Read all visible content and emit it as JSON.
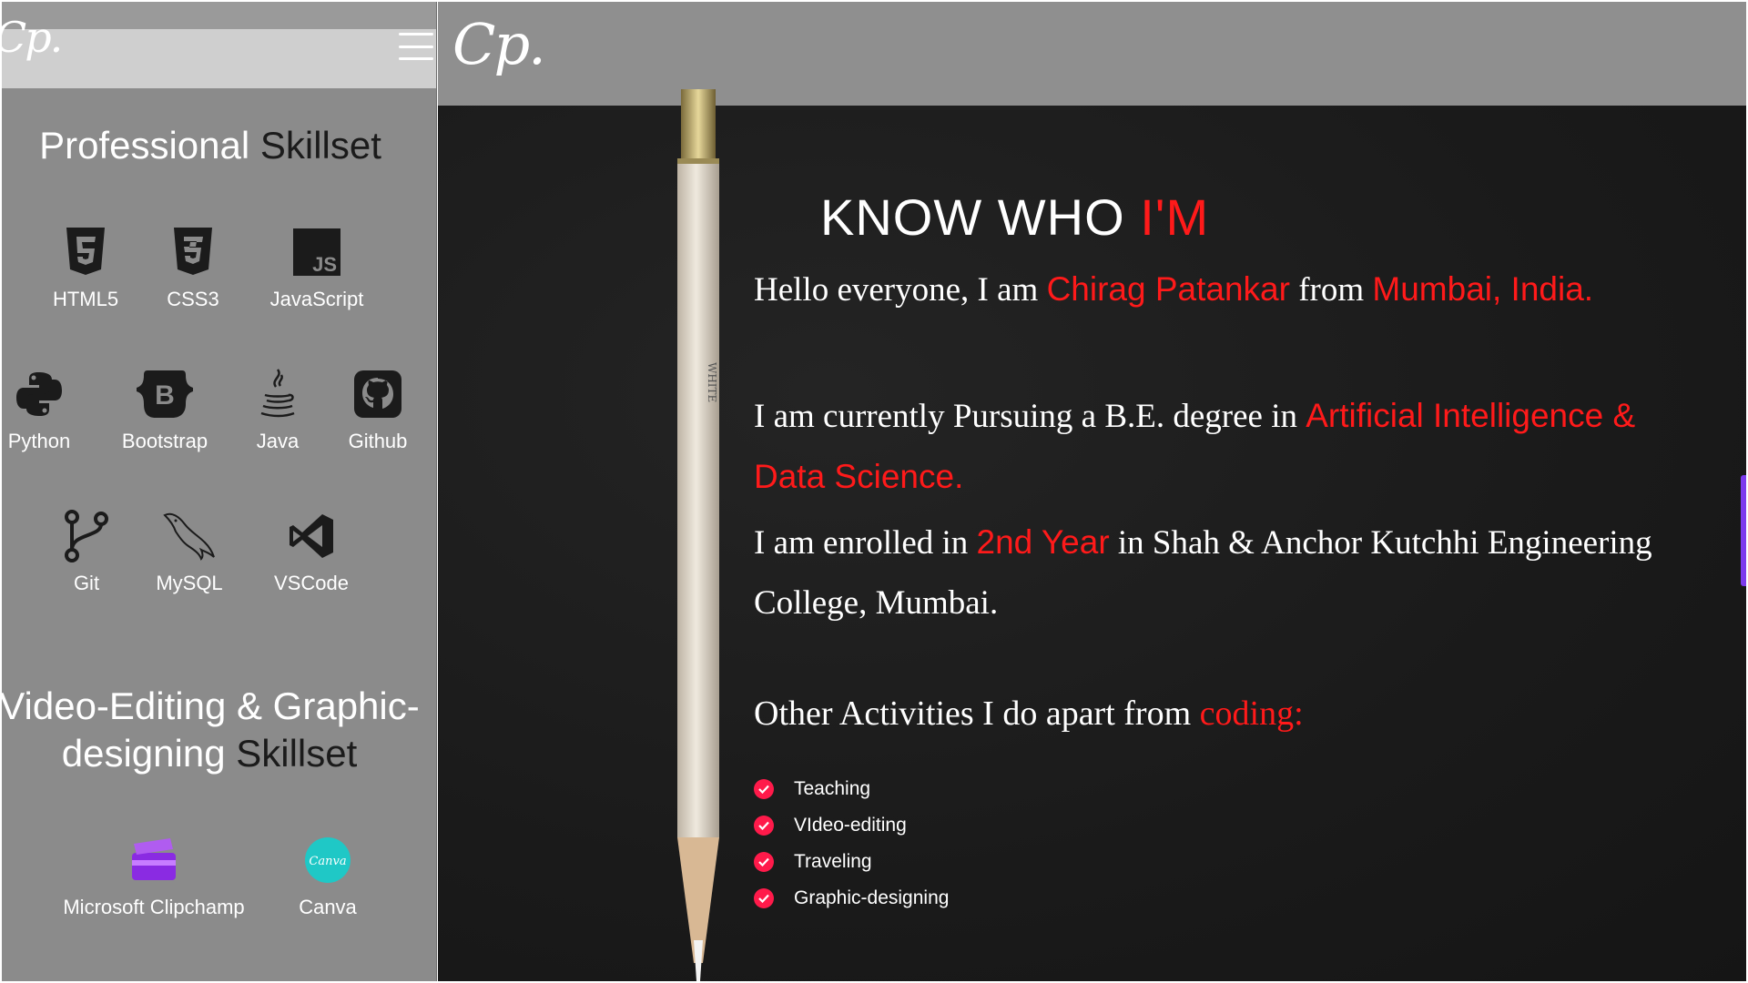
{
  "sidebar": {
    "logo": "Cp.",
    "professional_title": {
      "white": "Professional",
      "dark": "Skillset"
    },
    "skills": [
      {
        "label": "HTML5",
        "icon": "html5-icon"
      },
      {
        "label": "CSS3",
        "icon": "css3-icon"
      },
      {
        "label": "JavaScript",
        "icon": "javascript-icon"
      },
      {
        "label": "Python",
        "icon": "python-icon"
      },
      {
        "label": "Bootstrap",
        "icon": "bootstrap-icon"
      },
      {
        "label": "Java",
        "icon": "java-icon"
      },
      {
        "label": "Github",
        "icon": "github-icon"
      },
      {
        "label": "Git",
        "icon": "git-icon"
      },
      {
        "label": "MySQL",
        "icon": "mysql-icon"
      },
      {
        "label": "VSCode",
        "icon": "vscode-icon"
      }
    ],
    "video_title": {
      "white_line1": "Video-Editing & Graphic-",
      "white_line2": "designing",
      "dark": "Skillset"
    },
    "video_skills": [
      {
        "label": "Microsoft Clipchamp",
        "icon": "clipchamp-icon"
      },
      {
        "label": "Canva",
        "icon": "canva-icon",
        "badge_text": "Canva"
      }
    ]
  },
  "main": {
    "logo": "Cp.",
    "headline": {
      "white": "KNOW WHO",
      "red": "I'M"
    },
    "para1": {
      "t1": "Hello everyone, I am ",
      "name": "Chirag Patankar",
      "t2": " from ",
      "place": "Mumbai, India."
    },
    "para2": {
      "t1": "I am currently Pursuing a B.E. degree in ",
      "degree": "Artificial Intelligence & Data Science."
    },
    "para3": {
      "t1": "I am enrolled in ",
      "year": "2nd Year",
      "t2": " in Shah & Anchor Kutchhi Engineering College, Mumbai."
    },
    "activities_title": {
      "white": "Other Activities I do apart from ",
      "red": "coding:"
    },
    "activities": [
      "Teaching",
      "VIdeo-editing",
      "Traveling",
      "Graphic-designing"
    ],
    "pencil_text": "WHITE",
    "colors": {
      "accent_red": "#ff1a1a",
      "check_pink": "#ff1a4a",
      "scroll_accent": "#7c3aed"
    }
  }
}
